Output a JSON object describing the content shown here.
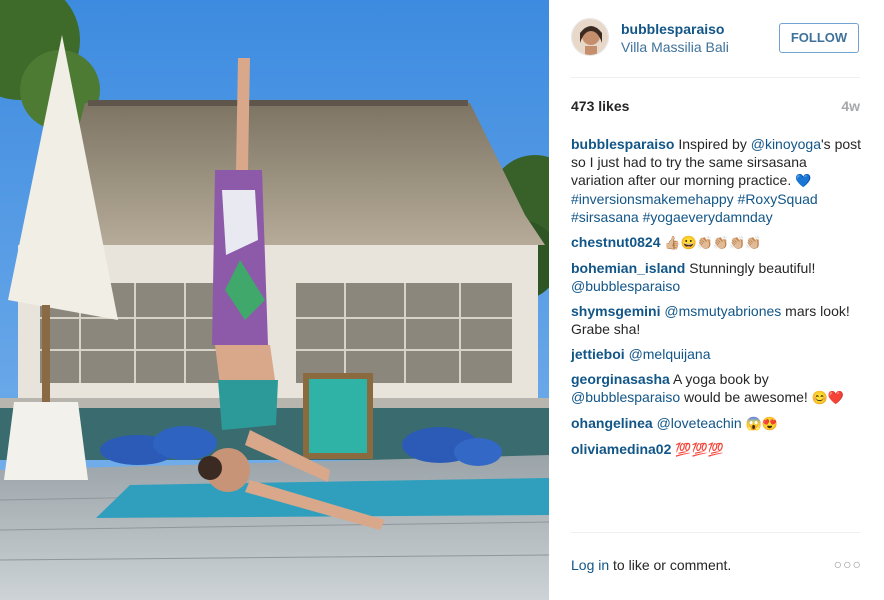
{
  "post": {
    "username": "bubblesparaiso",
    "location": "Villa Massilia Bali",
    "follow_label": "FOLLOW",
    "likes": "473 likes",
    "time_ago": "4w"
  },
  "caption": {
    "user": "bubblesparaiso",
    "text_1": "Inspired by ",
    "mention": "@kinoyoga",
    "text_2": "'s post so I just had to try the same sirsasana variation after our morning practice. ",
    "emoji": "💙",
    "tags": "#inversionsmakemehappy #RoxySquad #sirsasana #yogaeverydamnday"
  },
  "comments": [
    {
      "user": "chestnut0824",
      "mention": "",
      "text": "",
      "emoji": "👍🏼😀👏🏼👏🏼👏🏼👏🏼"
    },
    {
      "user": "bohemian_island",
      "mention": "",
      "text": "Stunningly beautiful! ",
      "emoji": "",
      "mention2": "@bubblesparaiso"
    },
    {
      "user": "shymsgemini",
      "mention": "@msmutyabriones",
      "text": " mars look! Grabe sha!",
      "emoji": ""
    },
    {
      "user": "jettieboi",
      "mention": "@melquijana",
      "text": "",
      "emoji": ""
    },
    {
      "user": "georginasasha",
      "mention": "",
      "text": "A yoga book by ",
      "mention2": "@bubblesparaiso",
      "text2": " would be awesome! ",
      "emoji": "😊❤️"
    },
    {
      "user": "ohangelinea",
      "mention": "@loveteachin",
      "text": " ",
      "emoji": "😱😍"
    },
    {
      "user": "oliviamedina02",
      "mention": "",
      "text": "",
      "emoji": "💯💯💯"
    }
  ],
  "footer": {
    "login_link": "Log in",
    "login_text": " to like or comment.",
    "more_label": "○○○"
  }
}
